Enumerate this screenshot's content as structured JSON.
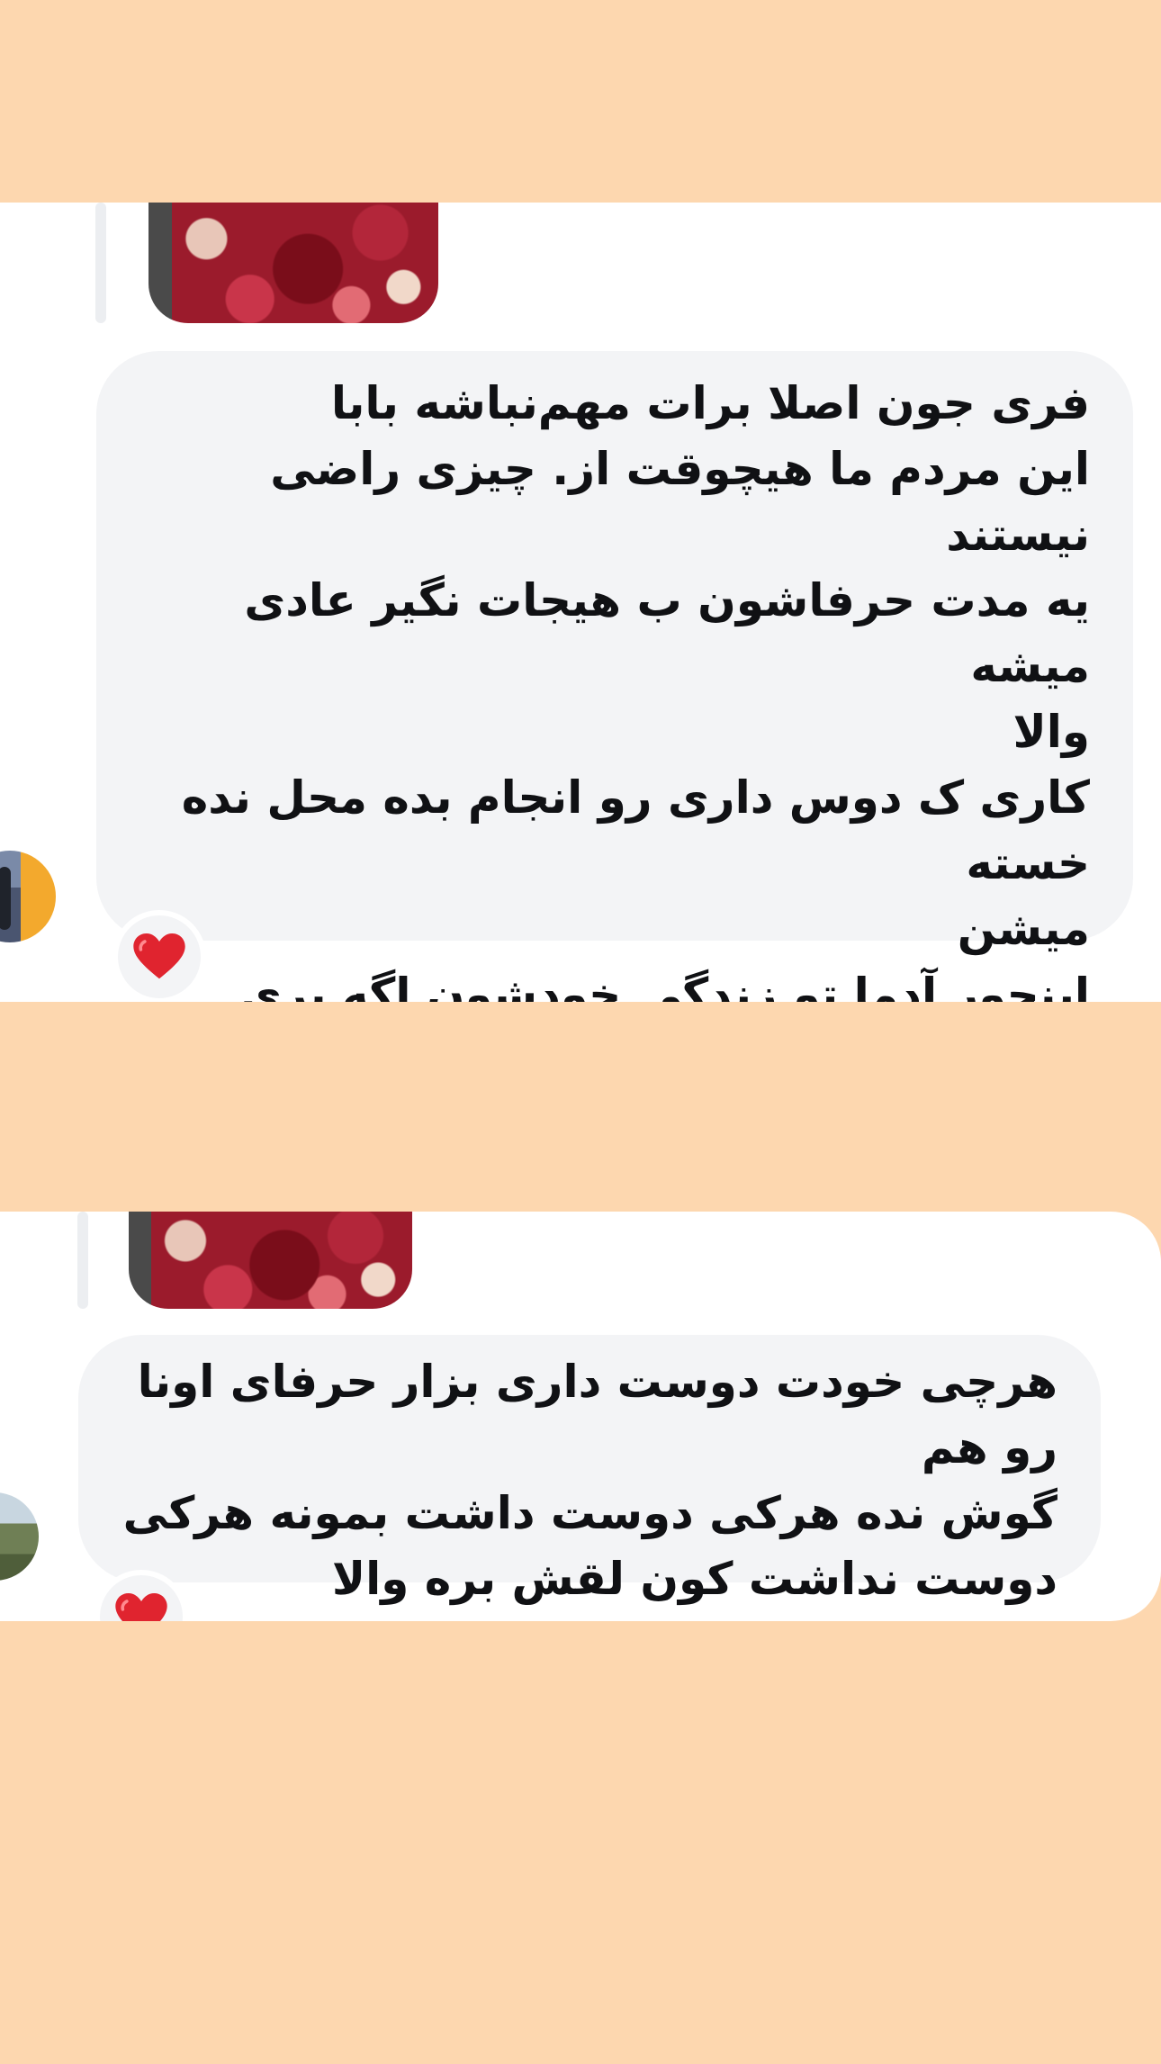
{
  "comments": [
    {
      "text": "فری جون اصلا برات مهم‌نباشه بابا\nاین مردم ما هیچوقت از. چیزی راضی نیستند\nیه مدت حرفاشون ب هیجات نگیر عادی میشه\nوالا\nکاری ک دوس داری رو انجام بده محل نده خسته\nمیشن\nاینجور آدما تو زندگی خودشون اگه بری میفهمی\nچه عجوبه های هستن غیر قابل تحمل",
      "reaction_icon": "heart-icon",
      "reaction_color": "#E0242F"
    },
    {
      "text": "هرچی خودت دوست داری بزار حرفای اونا رو هم\nگوش نده هرکی دوست داشت بمونه هرکی\nدوست نداشت کون لقش بره والا",
      "reaction_icon": "heart-icon",
      "reaction_color": "#E0242F"
    }
  ],
  "colors": {
    "background": "#FDD7AF",
    "card": "#FFFFFF",
    "bubble": "#F3F4F6",
    "text": "#101114",
    "heart": "#E0242F"
  }
}
